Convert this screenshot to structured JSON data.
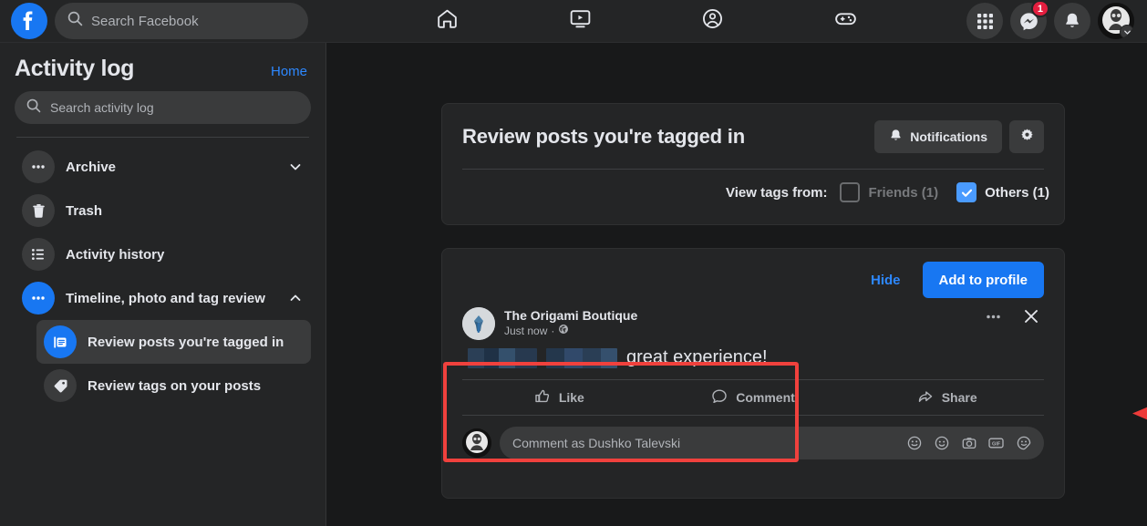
{
  "topnav": {
    "logo_icon": "facebook-logo-icon",
    "search": {
      "placeholder": "Search Facebook",
      "icon": "search-icon"
    },
    "tabs": [
      {
        "name": "home",
        "icon": "home-icon"
      },
      {
        "name": "watch",
        "icon": "video-icon"
      },
      {
        "name": "groups",
        "icon": "groups-icon"
      },
      {
        "name": "gaming",
        "icon": "gaming-icon"
      }
    ],
    "menu_icon": "grid-menu-icon",
    "messenger_icon": "messenger-icon",
    "messenger_badge": "1",
    "notifications_icon": "bell-icon",
    "account_icon": "account-avatar-icon"
  },
  "sidebar": {
    "title": "Activity log",
    "home_link": "Home",
    "search": {
      "placeholder": "Search activity log",
      "icon": "search-icon"
    },
    "items": [
      {
        "label": "Archive",
        "icon": "ellipsis-icon",
        "chevron": "down",
        "active": false
      },
      {
        "label": "Trash",
        "icon": "trash-icon",
        "chevron": "",
        "active": false
      },
      {
        "label": "Activity history",
        "icon": "list-icon",
        "chevron": "",
        "active": false
      },
      {
        "label": "Timeline, photo and tag review",
        "icon": "ellipsis-icon",
        "chevron": "up",
        "active": true
      }
    ],
    "subitems": [
      {
        "label": "Review posts you're tagged in",
        "icon": "review-posts-icon",
        "active": true
      },
      {
        "label": "Review tags on your posts",
        "icon": "tag-icon",
        "active": false
      }
    ]
  },
  "review_card": {
    "title": "Review posts you're tagged in",
    "notifications_button": "Notifications",
    "notifications_icon": "bell-icon",
    "settings_icon": "gear-icon",
    "filter_label": "View tags from:",
    "filters": [
      {
        "label": "Friends (1)",
        "checked": false
      },
      {
        "label": "Others (1)",
        "checked": true
      }
    ]
  },
  "post_card": {
    "hide_label": "Hide",
    "add_to_profile_label": "Add to profile",
    "author": "The Origami Boutique",
    "timestamp": "Just now",
    "privacy_icon": "globe-icon",
    "separator": "·",
    "text": "great experience!",
    "censored_blocks": 2,
    "more_icon": "ellipsis-icon",
    "close_icon": "close-icon",
    "engagements": [
      {
        "label": "Like",
        "icon": "thumbs-up-icon"
      },
      {
        "label": "Comment",
        "icon": "comment-bubble-icon"
      },
      {
        "label": "Share",
        "icon": "share-arrow-icon"
      }
    ],
    "comment_placeholder": "Comment as Dushko Talevski",
    "comment_icons": [
      "emoji-face-icon",
      "smiley-icon",
      "camera-icon",
      "gif-icon",
      "sticker-icon"
    ]
  },
  "annotation": {
    "highlight_color": "#f0413d",
    "arrow_direction": "left"
  },
  "colors": {
    "accent": "#1877f2",
    "link": "#2d88ff",
    "badge": "#e41e3f",
    "page_bg": "#18191a",
    "card_bg": "#242526"
  }
}
